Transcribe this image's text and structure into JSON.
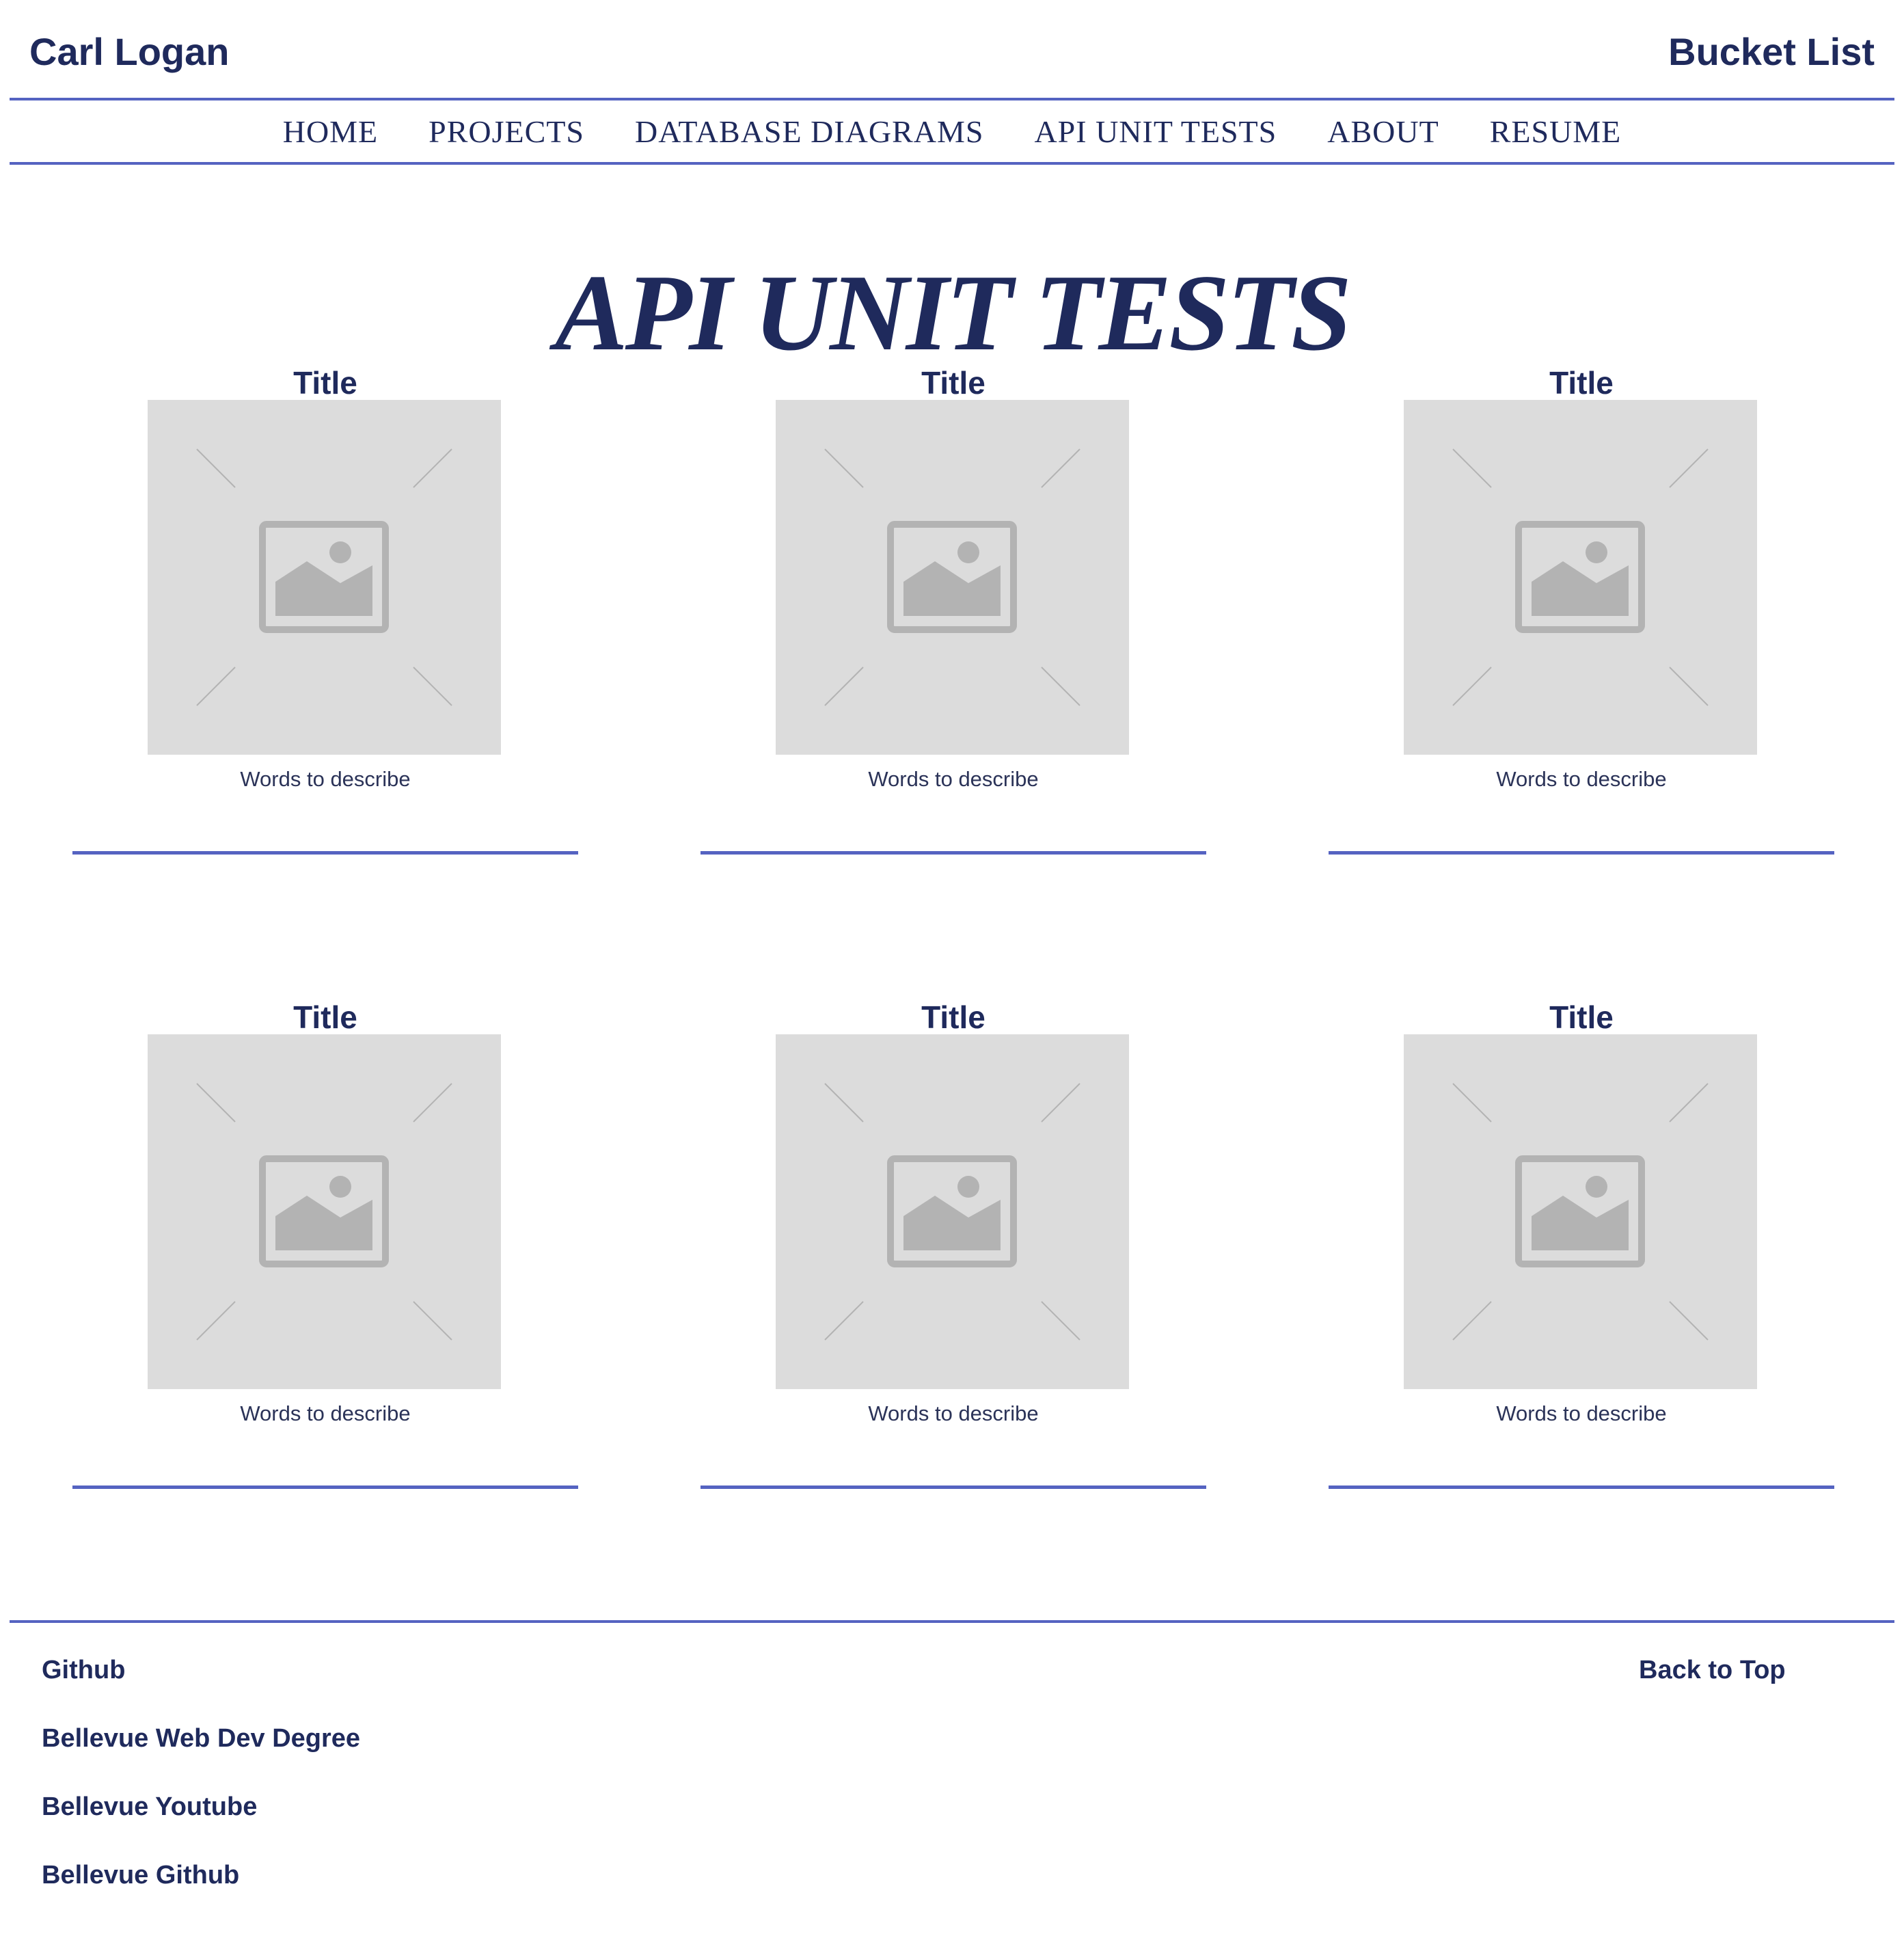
{
  "header": {
    "brand": "Carl Logan",
    "bucket_list": "Bucket List"
  },
  "nav": {
    "items": [
      {
        "label": "HOME"
      },
      {
        "label": "PROJECTS"
      },
      {
        "label": "DATABASE DIAGRAMS"
      },
      {
        "label": "API UNIT TESTS"
      },
      {
        "label": "ABOUT"
      },
      {
        "label": "RESUME"
      }
    ]
  },
  "main": {
    "title": "API UNIT TESTS",
    "cards": [
      {
        "title": "Title",
        "description": "Words to describe",
        "image_icon": "image-placeholder-icon"
      },
      {
        "title": "Title",
        "description": "Words to describe",
        "image_icon": "image-placeholder-icon"
      },
      {
        "title": "Title",
        "description": "Words to describe",
        "image_icon": "image-placeholder-icon"
      },
      {
        "title": "Title",
        "description": "Words to describe",
        "image_icon": "image-placeholder-icon"
      },
      {
        "title": "Title",
        "description": "Words to describe",
        "image_icon": "image-placeholder-icon"
      },
      {
        "title": "Title",
        "description": "Words to describe",
        "image_icon": "image-placeholder-icon"
      }
    ]
  },
  "footer": {
    "links": [
      {
        "label": "Github"
      },
      {
        "label": "Bellevue Web Dev Degree"
      },
      {
        "label": "Bellevue Youtube"
      },
      {
        "label": "Bellevue Github"
      }
    ],
    "back_to_top": "Back to Top"
  },
  "colors": {
    "text": "#1f2a5c",
    "accent_rule": "#5563c1",
    "placeholder_bg": "#dcdcdc",
    "placeholder_icon": "#b3b3b3"
  }
}
